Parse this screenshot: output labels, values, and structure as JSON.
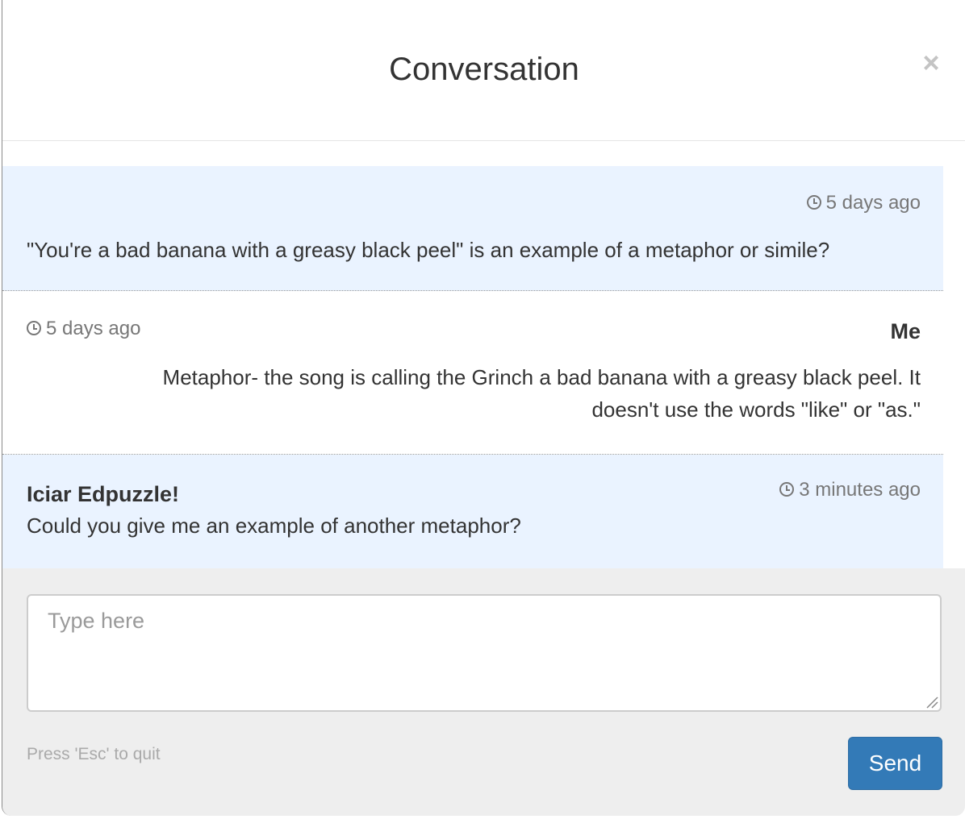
{
  "dialog": {
    "title": "Conversation",
    "close_symbol": "×"
  },
  "messages": [
    {
      "role": "other",
      "author": "",
      "time": "5 days ago",
      "text": "\"You're a bad banana with a greasy black peel\" is an example of a metaphor or simile?"
    },
    {
      "role": "mine",
      "author": "Me",
      "time": "5 days ago",
      "text_line1": "Metaphor- the song is calling the Grinch a bad banana with a greasy black peel. It",
      "text_line2": "doesn't use the words \"like\" or \"as.\""
    },
    {
      "role": "other",
      "author": "Iciar Edpuzzle!",
      "time": "3 minutes ago",
      "text": "Could you give me an example of another metaphor?"
    }
  ],
  "reply": {
    "value": "",
    "placeholder": "Type here"
  },
  "footer": {
    "hint": "Press 'Esc' to quit",
    "send_label": "Send"
  },
  "colors": {
    "other_message_bg": "#eaf3ff",
    "send_button": "#337ab7",
    "footer_bg": "#eeeeee"
  },
  "icons": {
    "close": "close-icon",
    "time": "clock-icon"
  }
}
